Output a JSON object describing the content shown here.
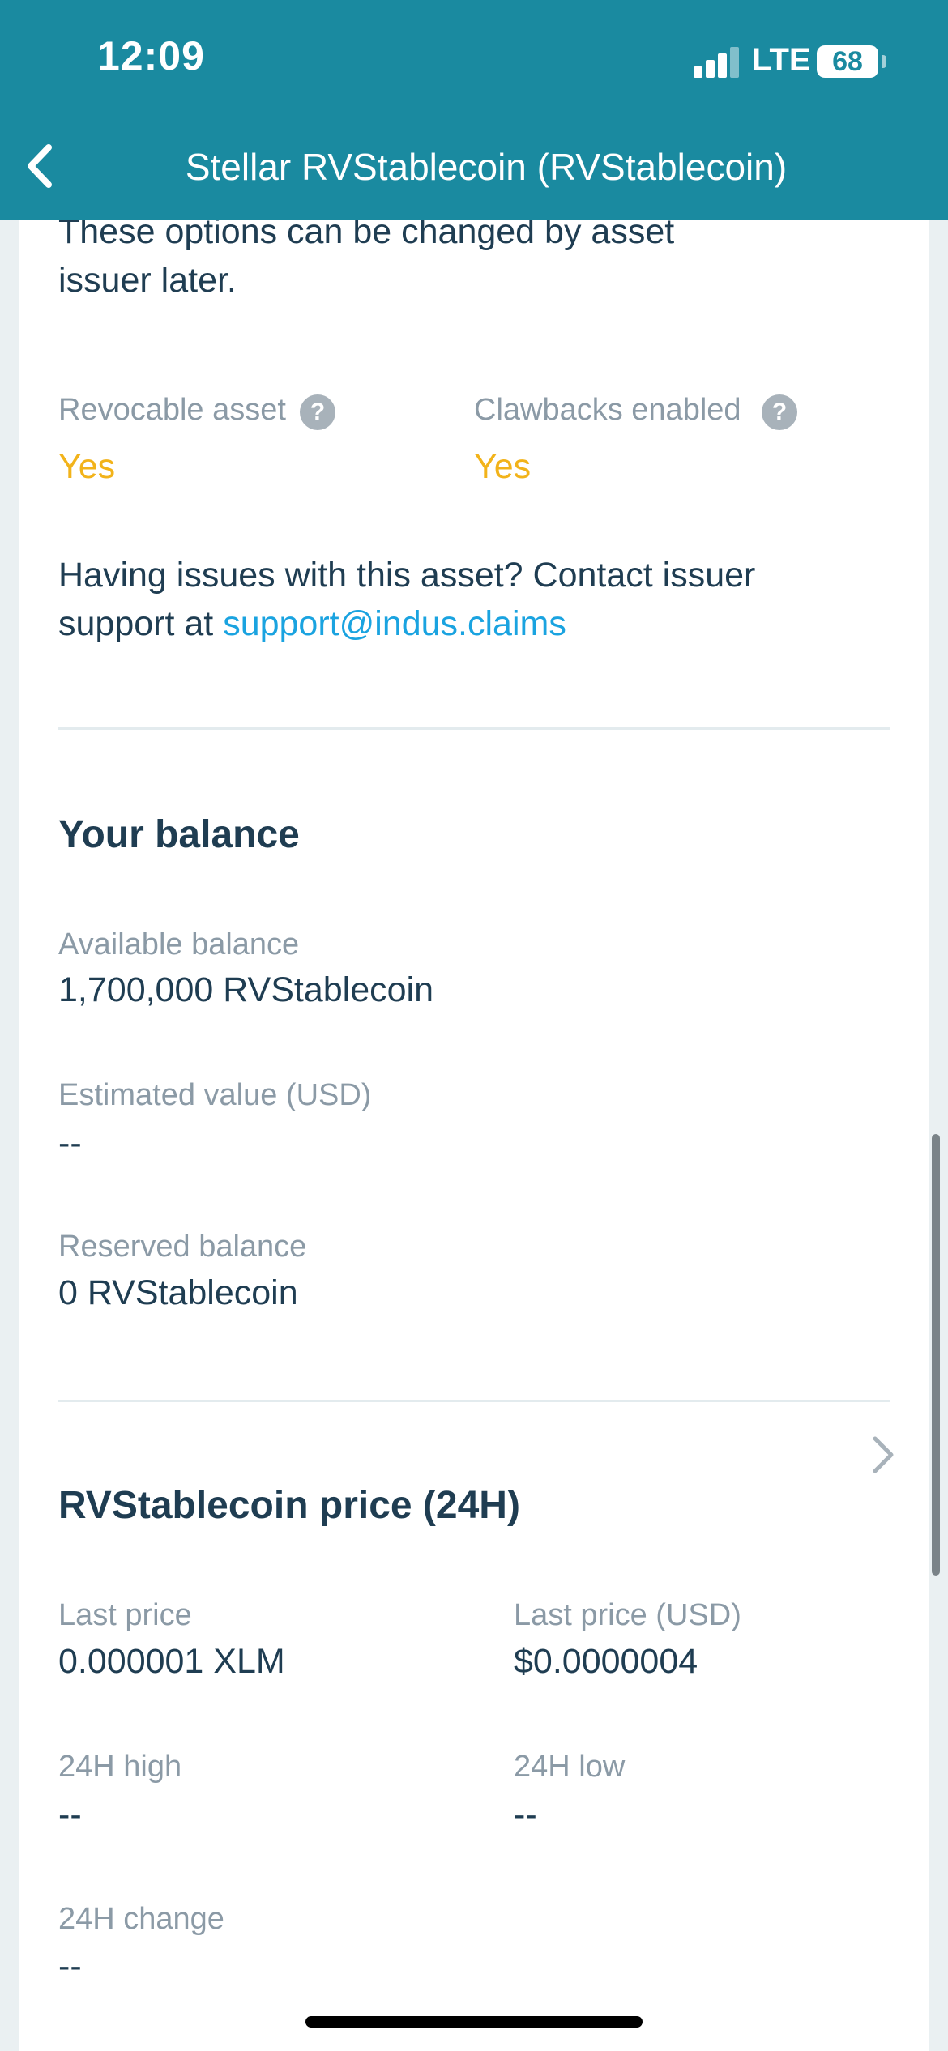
{
  "status_bar": {
    "time": "12:09",
    "network": "LTE",
    "battery": "68"
  },
  "nav": {
    "title": "Stellar RVStablecoin (RVStablecoin)"
  },
  "asset_options": {
    "intro_line1": "These options can be changed by asset",
    "intro_line2": "issuer later.",
    "revocable_label": "Revocable asset",
    "revocable_value": "Yes",
    "clawbacks_label": "Clawbacks enabled",
    "clawbacks_value": "Yes",
    "help_glyph": "?"
  },
  "support": {
    "line1": "Having issues with this asset? Contact issuer",
    "line2_prefix": "support at ",
    "email": "support@indus.claims"
  },
  "balance": {
    "heading": "Your balance",
    "available_label": "Available balance",
    "available_value": "1,700,000 RVStablecoin",
    "estimated_label": "Estimated value (USD)",
    "estimated_value": "--",
    "reserved_label": "Reserved balance",
    "reserved_value": "0 RVStablecoin"
  },
  "price": {
    "heading": "RVStablecoin price (24H)",
    "last_price_label": "Last price",
    "last_price_value": "0.000001 XLM",
    "last_price_usd_label": "Last price (USD)",
    "last_price_usd_value": "$0.0000004",
    "high_label": "24H high",
    "high_value": "--",
    "low_label": "24H low",
    "low_value": "--",
    "change_label": "24H change",
    "change_value": "--"
  },
  "colors": {
    "header_bg": "#1a8aa0",
    "accent_yellow": "#f2b31a",
    "link_blue": "#1aa3e0",
    "text_dark": "#1f3d52",
    "text_gray": "#8b9aa6"
  }
}
